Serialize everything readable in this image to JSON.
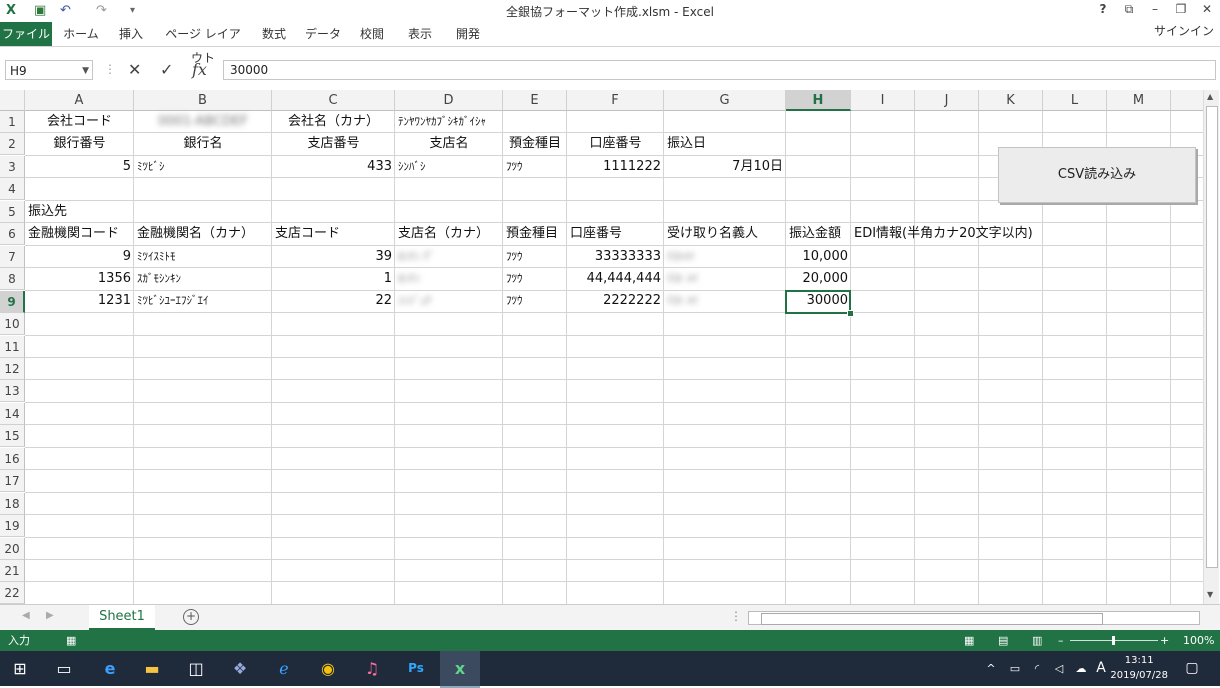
{
  "window": {
    "title": "全銀協フォーマット作成.xlsm - Excel",
    "help": "?",
    "signin": "サインイン"
  },
  "ribbon": {
    "tabs": [
      "ファイル",
      "ホーム",
      "挿入",
      "ページ レイアウト",
      "数式",
      "データ",
      "校閲",
      "表示",
      "開発"
    ]
  },
  "formula_bar": {
    "name_box": "H9",
    "value": "30000",
    "fx": "fx"
  },
  "columns": [
    "A",
    "B",
    "C",
    "D",
    "E",
    "F",
    "G",
    "H",
    "I",
    "J",
    "K",
    "L",
    "M"
  ],
  "rows": [
    "1",
    "2",
    "3",
    "4",
    "5",
    "6",
    "7",
    "8",
    "9",
    "10",
    "11",
    "12",
    "13",
    "14",
    "15",
    "16",
    "17",
    "18",
    "19",
    "20",
    "21",
    "22"
  ],
  "cells": {
    "r1": {
      "a": "会社コード",
      "c": "会社名（カナ）",
      "d": "ﾃﾝﾔﾜﾝﾔｶﾌﾞｼｷｶﾞｲｼｬ",
      "b_blur": "0001-ABCDEF"
    },
    "r2": {
      "a": "銀行番号",
      "b": "銀行名",
      "c": "支店番号",
      "d": "支店名",
      "e": "預金種目",
      "f": "口座番号",
      "g": "振込日"
    },
    "r3": {
      "a": "5",
      "b": "ﾐﾂﾋﾞｼ",
      "c": "433",
      "d": "ｼﾝﾊﾞｼ",
      "e": "ﾌﾂｳ",
      "f": "1111222",
      "g": "7月10日"
    },
    "r5": {
      "a": "振込先"
    },
    "r6": {
      "a": "金融機関コード",
      "b": "金融機関名（カナ）",
      "c": "支店コード",
      "d": "支店名（カナ）",
      "e": "預金種目",
      "f": "口座番号",
      "g": "受け取り名義人",
      "h": "振込金額",
      "i": "EDI情報(半角カナ20文字以内)"
    },
    "r7": {
      "a": "9",
      "b": "ﾐﾂｲｽﾐﾄﾓ",
      "c": "39",
      "d_blur": "ﾎﾝﾃﾝ ﾃﾞ",
      "e": "ﾌﾂｳ",
      "f": "33333333",
      "g_blur": "ﾃｽﾄﾒｲ",
      "h": "10,000"
    },
    "r8": {
      "a": "1356",
      "b": "ｽｶﾞﾓｼﾝｷﾝ",
      "c": "1",
      "d_blur": "ﾎﾝﾃﾝ",
      "e": "ﾌﾂｳ",
      "f": "44,444,444",
      "g_blur": "ﾃｽﾄ ﾒｲ",
      "h": "20,000"
    },
    "r9": {
      "a": "1231",
      "b": "ﾐﾂﾋﾞｼﾕｰｴﾌｼﾞｴｲ",
      "c": "22",
      "d_blur": "ｼﾝｼﾞｭｸ",
      "e": "ﾌﾂｳ",
      "f": "2222222",
      "g_blur": "ﾃｽﾄ ﾒｲ",
      "h": "30000"
    }
  },
  "csv_button": "CSV読み込み",
  "sheets": [
    "Sheet1"
  ],
  "status": {
    "mode": "入力",
    "zoom": "100%"
  },
  "clock": {
    "time": "13:11",
    "date": "2019/07/28"
  },
  "ime": "A"
}
